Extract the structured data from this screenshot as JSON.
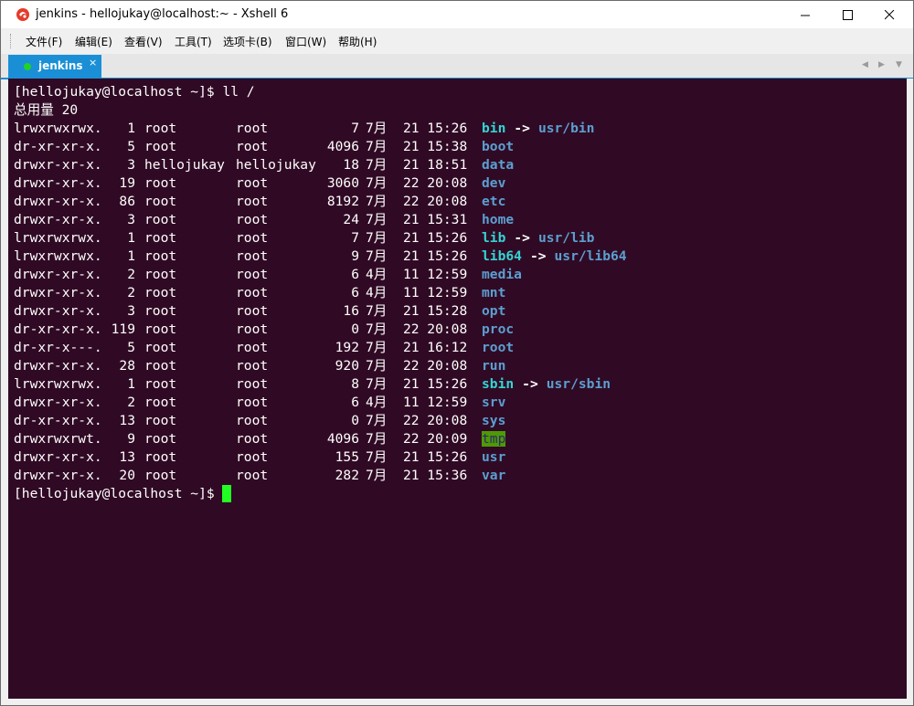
{
  "window": {
    "title": "jenkins - hellojukay@localhost:~ - Xshell 6",
    "controls": {
      "minimize": "—",
      "maximize": "☐",
      "close": "✕"
    }
  },
  "menu": [
    "文件(F)",
    "编辑(E)",
    "查看(V)",
    "工具(T)",
    "选项卡(B)",
    "窗口(W)",
    "帮助(H)"
  ],
  "tab": {
    "label": "jenkins",
    "close": "×",
    "nav_left": "◀",
    "nav_right": "▶",
    "nav_menu": "▼"
  },
  "terminal": {
    "command_line": "[hellojukay@localhost ~]$ ll /",
    "total": "总用量 20",
    "entries": [
      {
        "perm": "lrwxrwxrwx.",
        "links": "1",
        "owner": "root",
        "group": "root",
        "size": "7",
        "date": "7月  21 15:26",
        "name": "bin",
        "type": "link",
        "arrow": "->",
        "target": "usr/bin"
      },
      {
        "perm": "dr-xr-xr-x.",
        "links": "5",
        "owner": "root",
        "group": "root",
        "size": "4096",
        "date": "7月  21 15:38",
        "name": "boot",
        "type": "dir"
      },
      {
        "perm": "drwxr-xr-x.",
        "links": "3",
        "owner": "hellojukay",
        "group": "hellojukay",
        "size": "18",
        "date": "7月  21 18:51",
        "name": "data",
        "type": "dir"
      },
      {
        "perm": "drwxr-xr-x.",
        "links": "19",
        "owner": "root",
        "group": "root",
        "size": "3060",
        "date": "7月  22 20:08",
        "name": "dev",
        "type": "dir"
      },
      {
        "perm": "drwxr-xr-x.",
        "links": "86",
        "owner": "root",
        "group": "root",
        "size": "8192",
        "date": "7月  22 20:08",
        "name": "etc",
        "type": "dir"
      },
      {
        "perm": "drwxr-xr-x.",
        "links": "3",
        "owner": "root",
        "group": "root",
        "size": "24",
        "date": "7月  21 15:31",
        "name": "home",
        "type": "dir"
      },
      {
        "perm": "lrwxrwxrwx.",
        "links": "1",
        "owner": "root",
        "group": "root",
        "size": "7",
        "date": "7月  21 15:26",
        "name": "lib",
        "type": "link",
        "arrow": "->",
        "target": "usr/lib"
      },
      {
        "perm": "lrwxrwxrwx.",
        "links": "1",
        "owner": "root",
        "group": "root",
        "size": "9",
        "date": "7月  21 15:26",
        "name": "lib64",
        "type": "link",
        "arrow": "->",
        "target": "usr/lib64"
      },
      {
        "perm": "drwxr-xr-x.",
        "links": "2",
        "owner": "root",
        "group": "root",
        "size": "6",
        "date": "4月  11 12:59",
        "name": "media",
        "type": "dir"
      },
      {
        "perm": "drwxr-xr-x.",
        "links": "2",
        "owner": "root",
        "group": "root",
        "size": "6",
        "date": "4月  11 12:59",
        "name": "mnt",
        "type": "dir"
      },
      {
        "perm": "drwxr-xr-x.",
        "links": "3",
        "owner": "root",
        "group": "root",
        "size": "16",
        "date": "7月  21 15:28",
        "name": "opt",
        "type": "dir"
      },
      {
        "perm": "dr-xr-xr-x.",
        "links": "119",
        "owner": "root",
        "group": "root",
        "size": "0",
        "date": "7月  22 20:08",
        "name": "proc",
        "type": "dir"
      },
      {
        "perm": "dr-xr-x---.",
        "links": "5",
        "owner": "root",
        "group": "root",
        "size": "192",
        "date": "7月  21 16:12",
        "name": "root",
        "type": "dir"
      },
      {
        "perm": "drwxr-xr-x.",
        "links": "28",
        "owner": "root",
        "group": "root",
        "size": "920",
        "date": "7月  22 20:08",
        "name": "run",
        "type": "dir"
      },
      {
        "perm": "lrwxrwxrwx.",
        "links": "1",
        "owner": "root",
        "group": "root",
        "size": "8",
        "date": "7月  21 15:26",
        "name": "sbin",
        "type": "link",
        "arrow": "->",
        "target": "usr/sbin"
      },
      {
        "perm": "drwxr-xr-x.",
        "links": "2",
        "owner": "root",
        "group": "root",
        "size": "6",
        "date": "4月  11 12:59",
        "name": "srv",
        "type": "dir"
      },
      {
        "perm": "dr-xr-xr-x.",
        "links": "13",
        "owner": "root",
        "group": "root",
        "size": "0",
        "date": "7月  22 20:08",
        "name": "sys",
        "type": "dir"
      },
      {
        "perm": "drwxrwxrwt.",
        "links": "9",
        "owner": "root",
        "group": "root",
        "size": "4096",
        "date": "7月  22 20:09",
        "name": "tmp",
        "type": "sticky"
      },
      {
        "perm": "drwxr-xr-x.",
        "links": "13",
        "owner": "root",
        "group": "root",
        "size": "155",
        "date": "7月  21 15:26",
        "name": "usr",
        "type": "dir"
      },
      {
        "perm": "drwxr-xr-x.",
        "links": "20",
        "owner": "root",
        "group": "root",
        "size": "282",
        "date": "7月  21 15:36",
        "name": "var",
        "type": "dir"
      }
    ],
    "prompt": "[hellojukay@localhost ~]$",
    "colors": {
      "background": "#300a24",
      "directory": "#5c9fd1",
      "symlink": "#34d4d4",
      "sticky_bg": "#4e9a06",
      "cursor": "#22ff22",
      "tab_accent": "#1a8fd6"
    }
  }
}
